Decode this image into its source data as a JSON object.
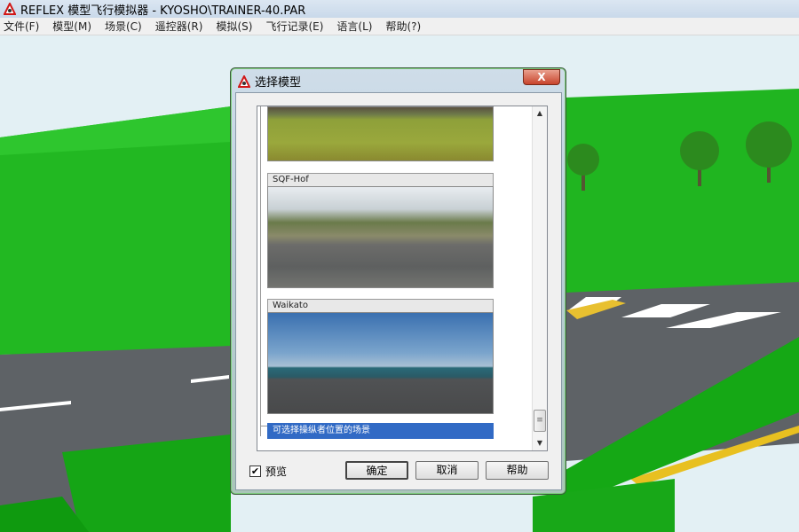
{
  "window": {
    "title": "REFLEX 模型飞行模拟器 - KYOSHO\\TRAINER-40.PAR"
  },
  "menu": [
    "文件(F)",
    "模型(M)",
    "场景(C)",
    "遥控器(R)",
    "模拟(S)",
    "飞行记录(E)",
    "语言(L)",
    "帮助(?)"
  ],
  "dialog": {
    "title": "选择模型",
    "close_label": "X",
    "scenes": [
      {
        "label": ""
      },
      {
        "label": "SQF-Hof"
      },
      {
        "label": "Waikato"
      }
    ],
    "selected_item": "可选择操纵者位置的场景",
    "preview_label": "预览",
    "preview_checked": true,
    "checkmark": "✔",
    "ok": "确定",
    "cancel": "取消",
    "help": "帮助",
    "scroll_up": "▲",
    "scroll_down": "▼",
    "scroll_grip": "≡"
  },
  "colors": {
    "selection": "#316ac5",
    "grass": "#1fbf1f"
  }
}
